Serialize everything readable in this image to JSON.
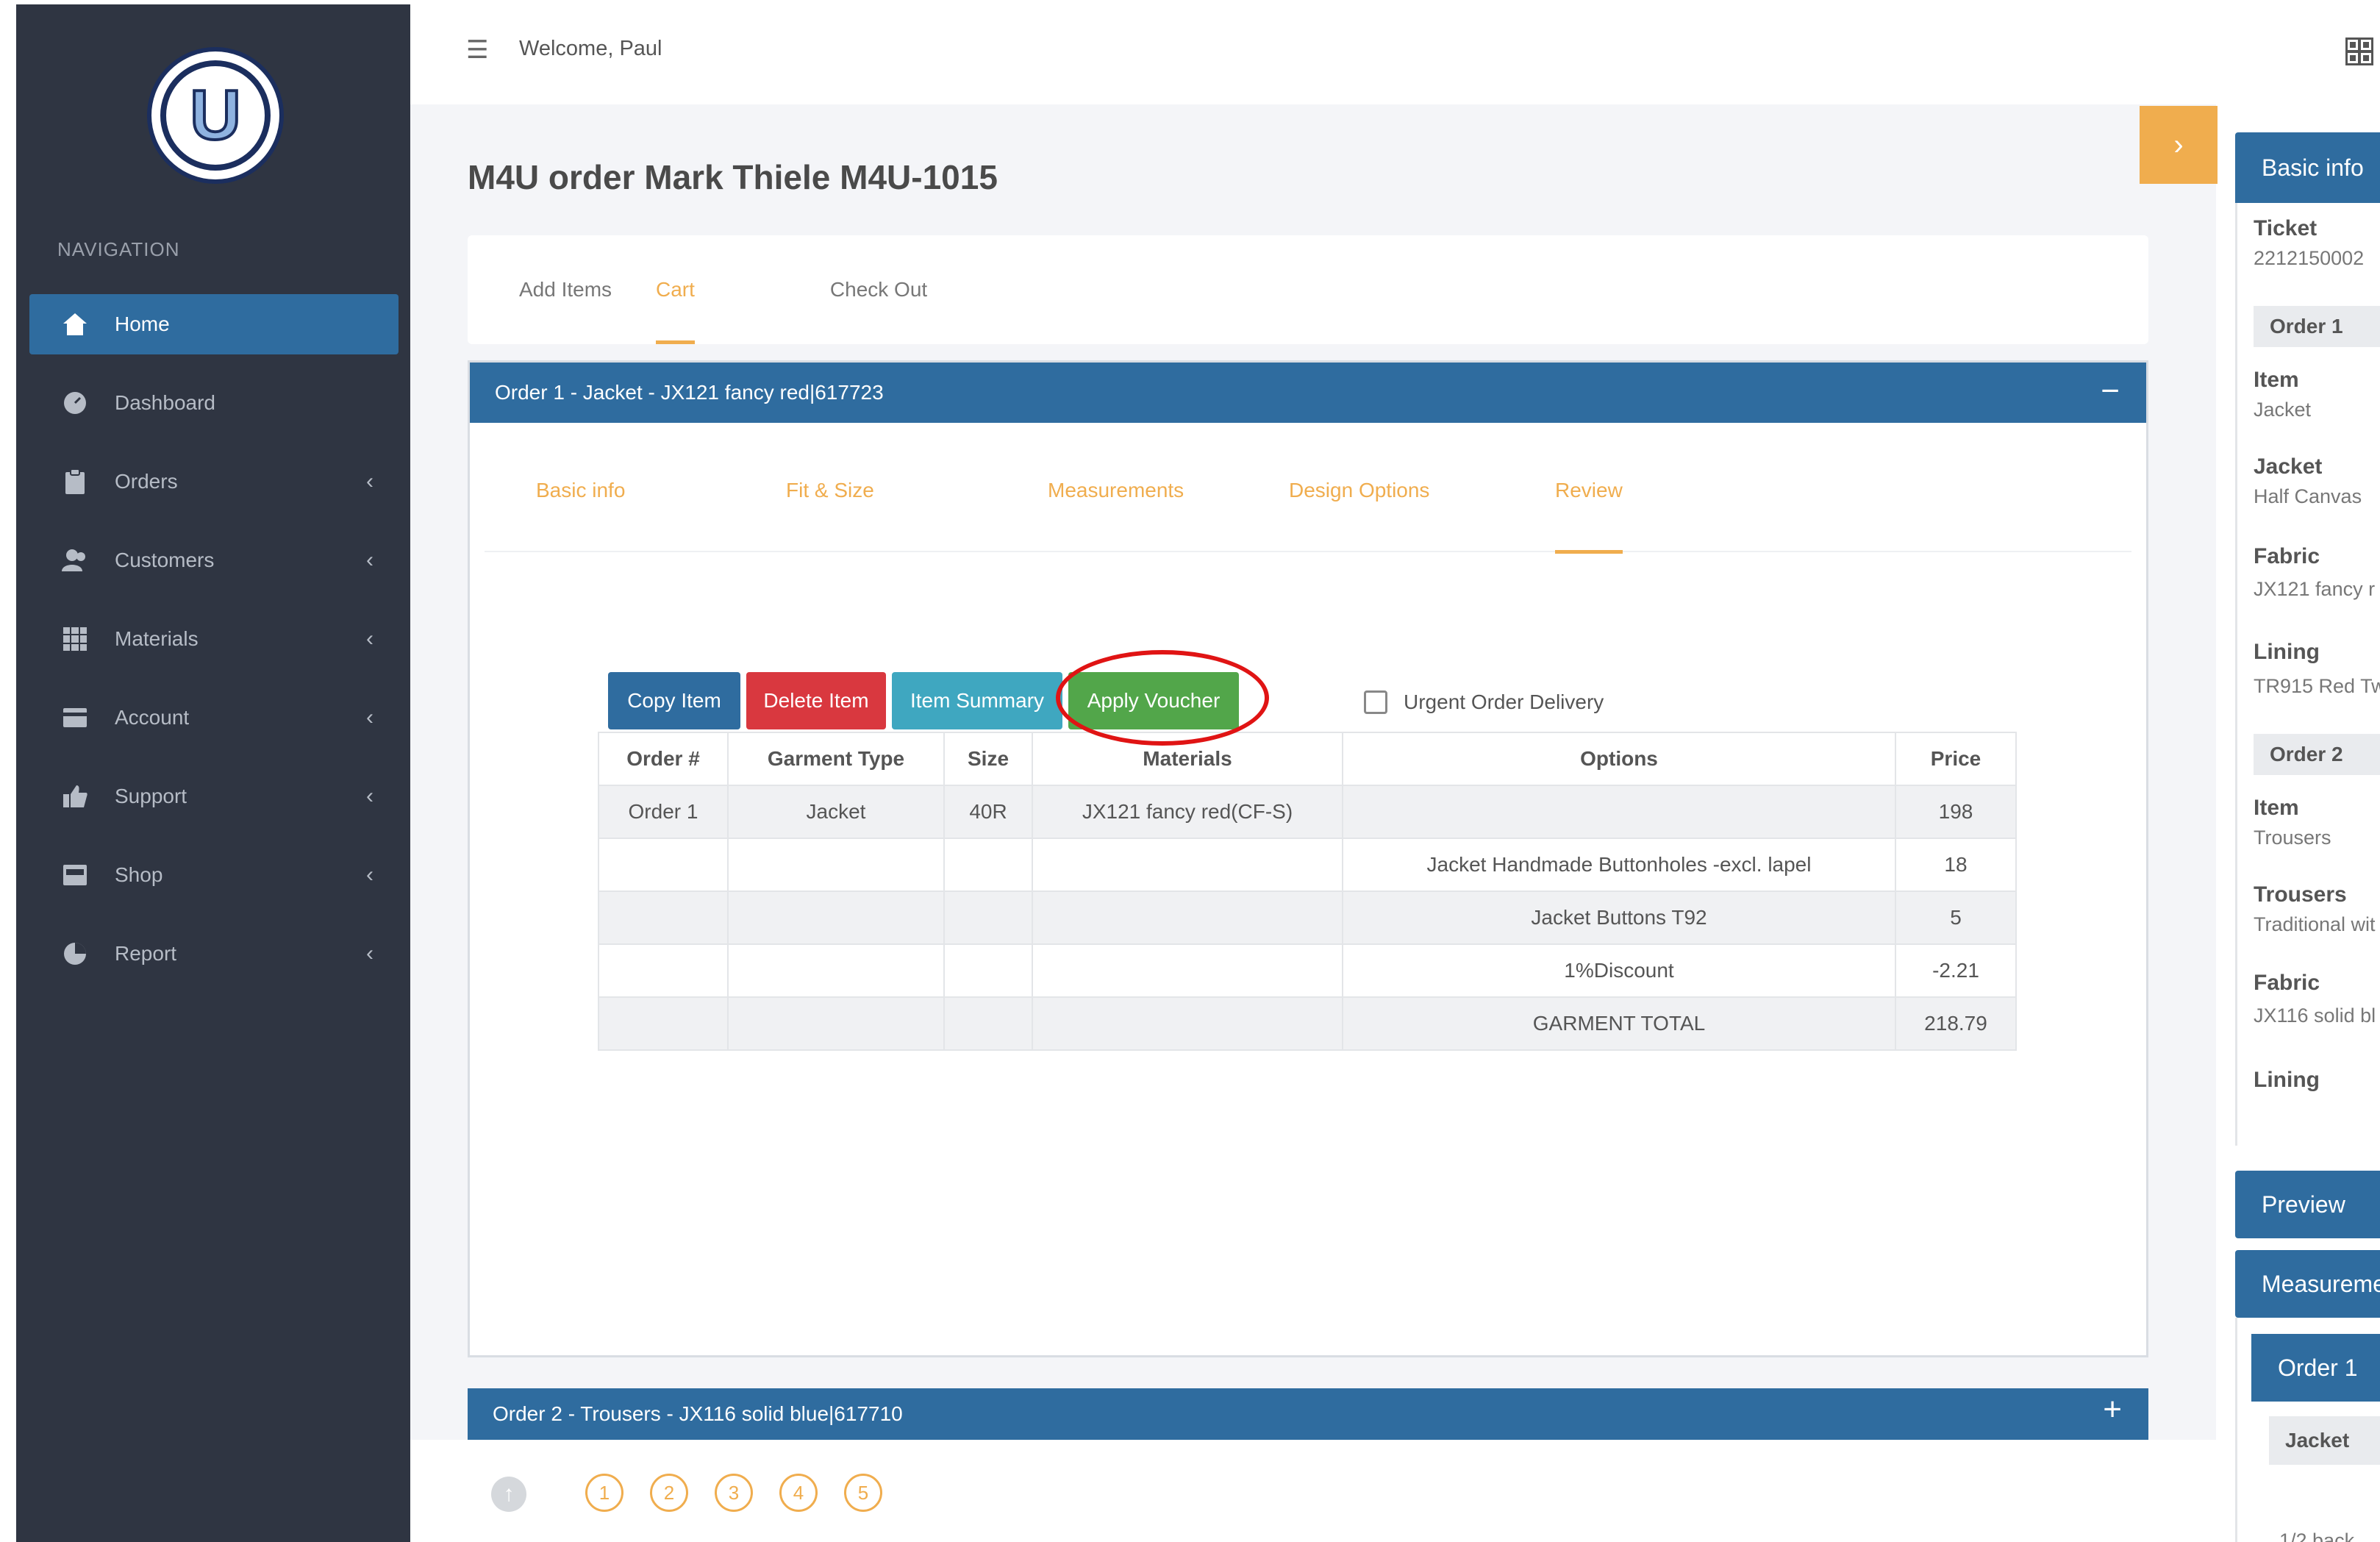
{
  "topbar": {
    "welcome": "Welcome, Paul"
  },
  "sidebar": {
    "heading": "NAVIGATION",
    "items": [
      {
        "label": "Home",
        "icon": "home-icon",
        "active": true
      },
      {
        "label": "Dashboard",
        "icon": "dashboard-icon"
      },
      {
        "label": "Orders",
        "icon": "clipboard-icon"
      },
      {
        "label": "Customers",
        "icon": "users-icon"
      },
      {
        "label": "Materials",
        "icon": "materials-icon"
      },
      {
        "label": "Account",
        "icon": "account-icon"
      },
      {
        "label": "Support",
        "icon": "thumbs-up-icon"
      },
      {
        "label": "Shop",
        "icon": "shop-icon"
      },
      {
        "label": "Report",
        "icon": "pie-chart-icon"
      }
    ]
  },
  "page": {
    "title": "M4U order Mark Thiele M4U-1015"
  },
  "steps_tabs": [
    "Add Items",
    "Cart",
    "Check Out"
  ],
  "order1": {
    "header": "Order 1 - Jacket - JX121 fancy red|617723",
    "tabs": [
      "Basic info",
      "Fit & Size",
      "Measurements",
      "Design Options",
      "Review"
    ],
    "buttons": {
      "copy": "Copy Item",
      "delete": "Delete Item",
      "summary": "Item Summary",
      "voucher": "Apply Voucher"
    },
    "urgent_label": "Urgent Order Delivery",
    "table": {
      "headers": [
        "Order #",
        "Garment Type",
        "Size",
        "Materials",
        "Options",
        "Price"
      ],
      "rows": [
        [
          "Order 1",
          "Jacket",
          "40R",
          "JX121 fancy red(CF-S)",
          "",
          "198"
        ],
        [
          "",
          "",
          "",
          "",
          "Jacket Handmade Buttonholes -excl. lapel",
          "18"
        ],
        [
          "",
          "",
          "",
          "",
          "Jacket Buttons T92",
          "5"
        ],
        [
          "",
          "",
          "",
          "",
          "1%Discount",
          "-2.21"
        ],
        [
          "",
          "",
          "",
          "",
          "GARMENT TOTAL",
          "218.79"
        ]
      ]
    }
  },
  "order2": {
    "header": "Order 2 - Trousers - JX116 solid blue|617710"
  },
  "pager": [
    "1",
    "2",
    "3",
    "4",
    "5"
  ],
  "right_panel": {
    "basic_info": "Basic info",
    "ticket_label": "Ticket",
    "ticket_value": "2212150002",
    "order1_band": "Order 1",
    "item_label": "Item",
    "item_value": "Jacket",
    "jacket_label": "Jacket",
    "jacket_value": "Half Canvas",
    "fabric_label": "Fabric",
    "fabric_value": "JX121 fancy r",
    "lining_label": "Lining",
    "lining_value": "TR915 Red Tw",
    "order2_band": "Order 2",
    "item2_label": "Item",
    "item2_value": "Trousers",
    "trousers_label": "Trousers",
    "trousers_value": "Traditional wit",
    "fabric2_label": "Fabric",
    "fabric2_value": "JX116 solid bl",
    "lining2_label": "Lining",
    "preview": "Preview",
    "measurements": "Measureme",
    "m_order1": "Order 1",
    "m_jacket": "Jacket",
    "m_cut": "1/2 back"
  },
  "colors": {
    "sidebar": "#2f3542",
    "primary": "#2f6c9f",
    "accent": "#f0ad4e",
    "danger": "#d9383f",
    "info": "#3fa7c0",
    "success": "#52a64a",
    "highlight_ring": "#e01414"
  }
}
